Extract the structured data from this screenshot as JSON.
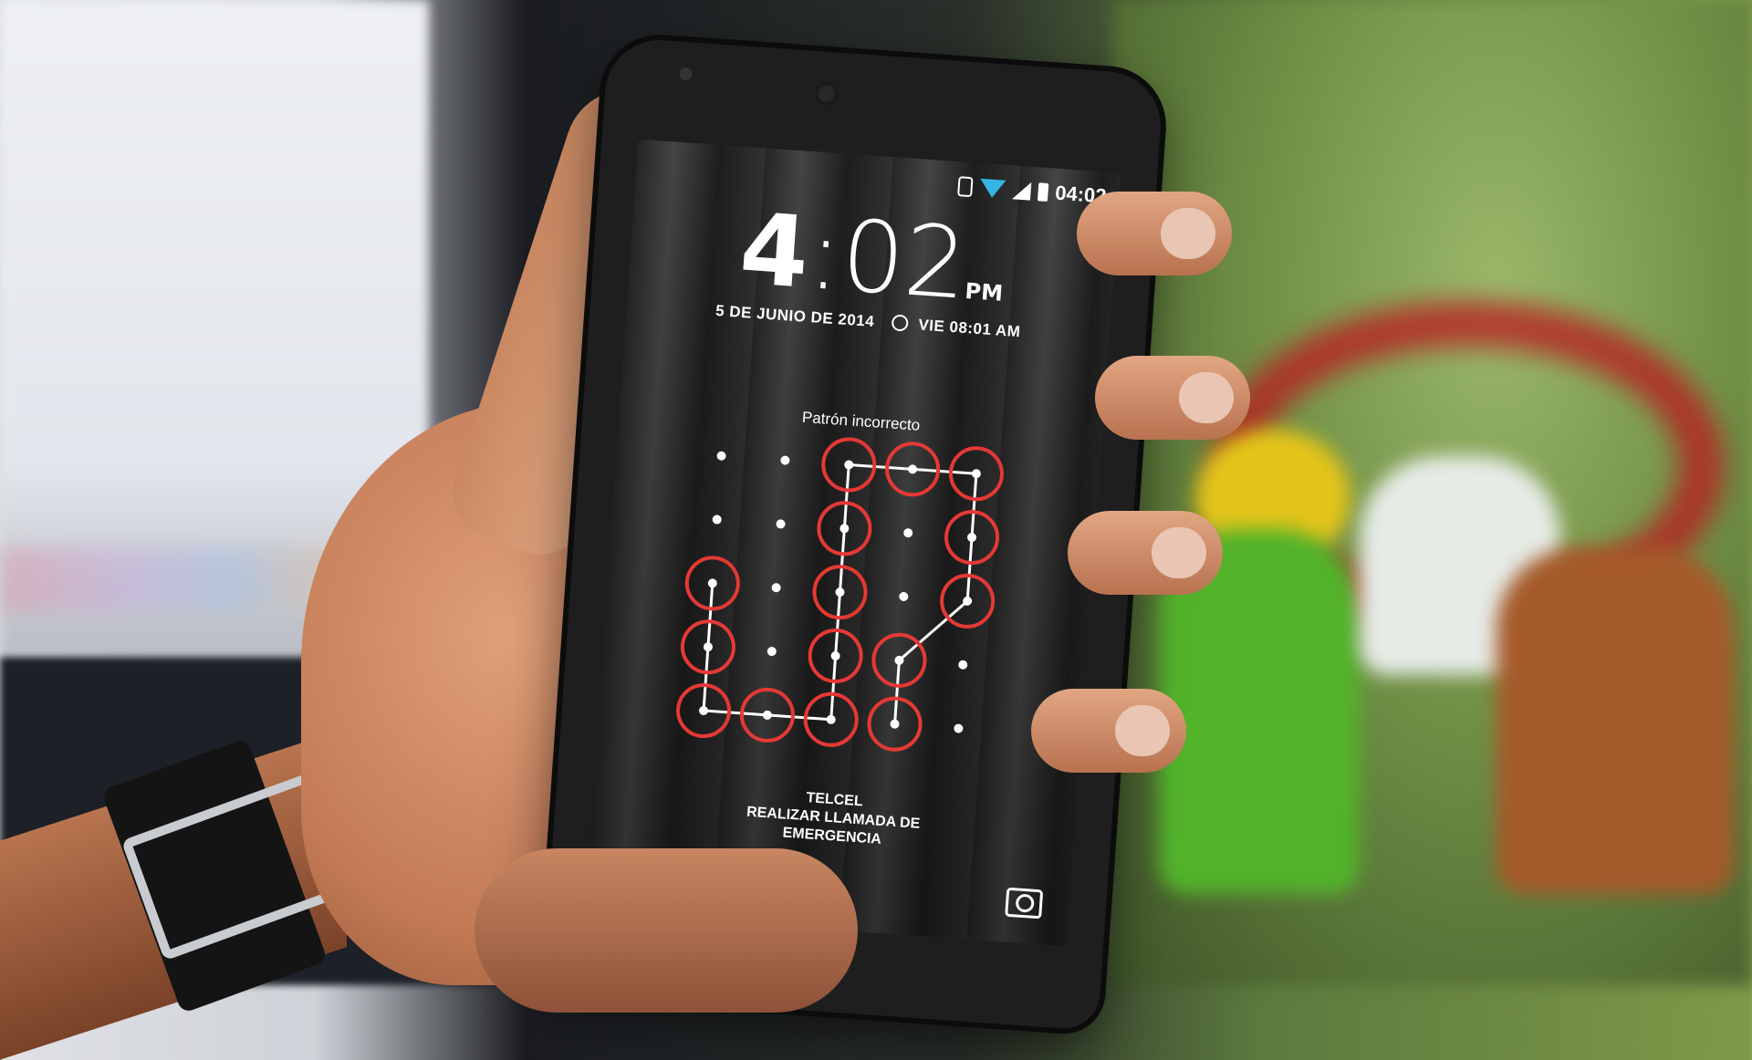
{
  "status_bar": {
    "time": "04:02",
    "icons": [
      "screen-rotation-icon",
      "wifi-icon",
      "signal-icon",
      "battery-icon"
    ],
    "wifi_color": "#33b5e5"
  },
  "lockscreen": {
    "clock_hour": "4",
    "clock_minutes": ":02",
    "clock_ampm": "PM",
    "date": "5 DE JUNIO DE 2014",
    "alarm": "VIE 08:01 AM",
    "pattern_message": "Patrón incorrecto",
    "carrier": "TELCEL",
    "emergency_call": "REALIZAR LLAMADA DE EMERGENCIA",
    "error_color": "#e53935"
  },
  "pattern": {
    "grid_size": 5,
    "selected_dots": [
      [
        0,
        2
      ],
      [
        0,
        3
      ],
      [
        0,
        4
      ],
      [
        1,
        2
      ],
      [
        1,
        4
      ],
      [
        2,
        0
      ],
      [
        2,
        2
      ],
      [
        2,
        4
      ],
      [
        3,
        0
      ],
      [
        3,
        2
      ],
      [
        3,
        3
      ],
      [
        4,
        0
      ],
      [
        4,
        1
      ],
      [
        4,
        2
      ],
      [
        4,
        3
      ]
    ]
  }
}
